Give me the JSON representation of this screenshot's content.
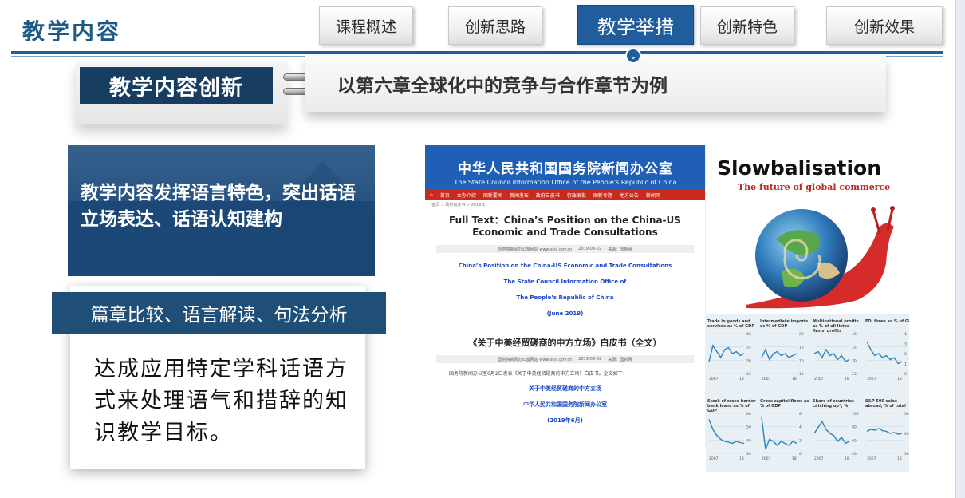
{
  "header": {
    "section_title": "教学内容",
    "tabs": [
      {
        "label": "课程概述",
        "active": false
      },
      {
        "label": "创新思路",
        "active": false
      },
      {
        "label": "教学举措",
        "active": true
      },
      {
        "label": "创新特色",
        "active": false
      },
      {
        "label": "创新效果",
        "active": false
      }
    ]
  },
  "topic": {
    "label": "教学内容创新",
    "description": "以第六章全球化中的竞争与合作章节为例"
  },
  "feature": {
    "text": "教学内容发挥语言特色，突出话语立场表达、话语认知建构"
  },
  "method": {
    "bar_label": "篇章比较、语言解读、句法分析",
    "text": "达成应用特定学科话语方式来处理语气和措辞的知识教学目标。"
  },
  "webpage": {
    "site_name": "中华人民共和国国务院新闻办公室",
    "site_name_en": "The State Council Information Office of the People's Republic of China",
    "nav_items": [
      "首页",
      "本办介绍",
      "国新要闻",
      "新闻发布",
      "政府白皮书",
      "行政审批",
      "国新专题",
      "地方公告",
      "新闻网"
    ],
    "breadcrumb": "首页 > 政府白皮书 > 2019年",
    "headline": "Full Text：China’s Position on the China-US Economic and Trade Consultations",
    "meta_source": "国务院新闻办公室网站  www.scio.gov.cn",
    "meta_date": "2019-06-02",
    "meta_from": "来源：国新网",
    "blue_lines": [
      "China’s Position on the China-US Economic and Trade Consultations",
      "The State Council Information Office of",
      "The People’s Republic of China",
      "(June 2019)"
    ],
    "cn_title": "《关于中美经贸磋商的中方立场》白皮书（全文）",
    "cn_meta_from": "来源：国新网",
    "cn_body": "国务院新闻办公室6月2日发表《关于中美经贸磋商的中方立场》白皮书。全文如下：",
    "cn_blue_lines": [
      "关于中美经贸磋商的中方立场",
      "中华人民共和国国务院新闻办公室",
      "(2019年6月)"
    ]
  },
  "magazine": {
    "title": "Slowbalisation",
    "subtitle": "The future of global commerce",
    "charts": [
      {
        "label": "Trade in goods and services as % of GDP",
        "y_ticks": [
          "60",
          "55",
          "50",
          "45"
        ],
        "x_ticks": [
          "2007",
          "18"
        ],
        "values": [
          0.3,
          0.7,
          0.55,
          0.4,
          0.6,
          0.65,
          0.5,
          0.55,
          0.45,
          0.5
        ]
      },
      {
        "label": "Intermediate imports as % of GDP",
        "y_ticks": [
          "20",
          "18",
          "16",
          "14"
        ],
        "x_ticks": [
          "2007",
          "18"
        ],
        "values": [
          0.4,
          0.6,
          0.35,
          0.5,
          0.55,
          0.45,
          0.5,
          0.4,
          0.45,
          0.5
        ]
      },
      {
        "label": "Multinational profits as % of all listed firms' profits",
        "y_ticks": [
          "40",
          "35",
          "30",
          "25"
        ],
        "x_ticks": [
          "2007",
          "18"
        ],
        "values": [
          0.5,
          0.55,
          0.4,
          0.6,
          0.45,
          0.5,
          0.35,
          0.45,
          0.3,
          0.35
        ]
      },
      {
        "label": "FDI flows as % of GDP",
        "y_ticks": [
          "4",
          "3",
          "2",
          "1",
          "0"
        ],
        "x_ticks": [
          "2007",
          "18"
        ],
        "values": [
          0.8,
          0.6,
          0.45,
          0.5,
          0.4,
          0.45,
          0.35,
          0.4,
          0.25,
          0.3
        ]
      },
      {
        "label": "Stock of cross-border bank loans as % of GDP",
        "y_ticks": [
          "60",
          "50",
          "40",
          "30"
        ],
        "x_ticks": [
          "2007",
          "18"
        ],
        "values": [
          0.85,
          0.6,
          0.45,
          0.35,
          0.3,
          0.28,
          0.25,
          0.3,
          0.27,
          0.25
        ]
      },
      {
        "label": "Gross capital flows as % of GDP",
        "y_ticks": [
          "6",
          "4",
          "2",
          "0"
        ],
        "x_ticks": [
          "2007",
          "18"
        ],
        "values": [
          0.9,
          0.1,
          0.35,
          0.3,
          0.2,
          0.3,
          0.25,
          0.2,
          0.3,
          0.25
        ]
      },
      {
        "label": "Share of countries catching up*, %",
        "y_ticks": [
          "100",
          "80",
          "60",
          "40"
        ],
        "x_ticks": [
          "2007",
          "18"
        ],
        "values": [
          0.5,
          0.65,
          0.8,
          0.6,
          0.5,
          0.45,
          0.3,
          0.4,
          0.25,
          0.3
        ]
      },
      {
        "label": "S&P 500 sales abroad, % of total",
        "y_ticks": [
          "50",
          "40",
          "30"
        ],
        "x_ticks": [
          "2007",
          "18"
        ],
        "values": [
          0.55,
          0.6,
          0.58,
          0.62,
          0.57,
          0.55,
          0.5,
          0.52,
          0.48,
          0.5
        ]
      }
    ]
  },
  "colors": {
    "brand_blue": "#1f5d9c",
    "navy": "#173d60",
    "banner_blue": "#1f4e77",
    "site_red": "#c82a1d",
    "mag_red": "#c0281e",
    "chart_line": "#2a84b8"
  }
}
